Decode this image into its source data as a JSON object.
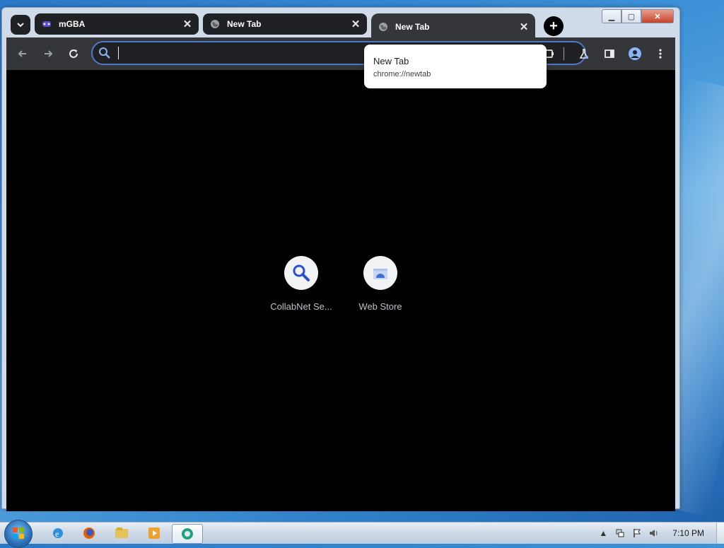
{
  "browser": {
    "tabs": [
      {
        "title": "mGBA",
        "icon": "mgba-icon",
        "active": false
      },
      {
        "title": "New Tab",
        "icon": "globe-icon",
        "active": false
      },
      {
        "title": "New Tab",
        "icon": "globe-icon",
        "active": true
      }
    ],
    "new_tab_symbol": "+",
    "tab_close_symbol": "✕",
    "omnibox": {
      "value": "",
      "placeholder": ""
    },
    "hovercard": {
      "title": "New Tab",
      "url": "chrome://newtab"
    }
  },
  "window_controls": {
    "minimize": "▁",
    "maximize": "▢",
    "close": "✕"
  },
  "shortcuts": [
    {
      "label": "CollabNet Se...",
      "icon": "search-icon"
    },
    {
      "label": "Web Store",
      "icon": "webstore-icon"
    }
  ],
  "taskbar": {
    "clock": "7:10 PM",
    "apps": [
      "ie-icon",
      "firefox-icon",
      "explorer-icon",
      "media-player-icon",
      "browser-icon"
    ]
  },
  "colors": {
    "tab_bg": "#202124",
    "toolbar_bg": "#35363a",
    "content_bg": "#000000",
    "omnibox_border": "#4f78c8"
  }
}
